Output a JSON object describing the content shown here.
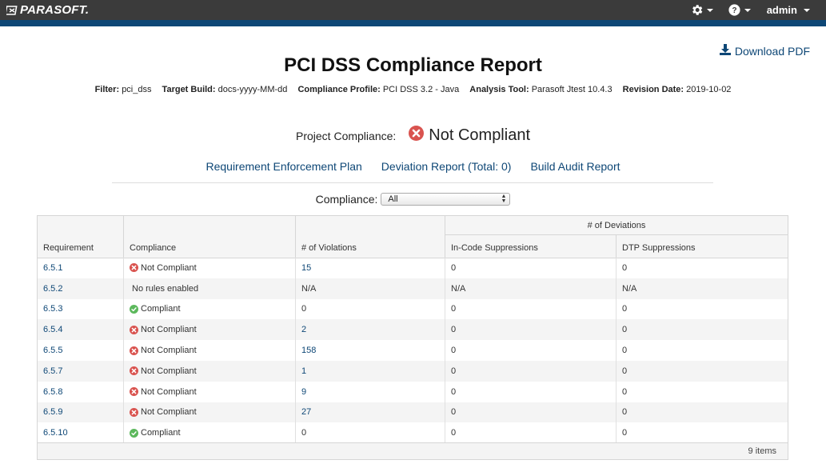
{
  "header": {
    "brand": "PARASOFT.",
    "user": "admin"
  },
  "download_label": "Download PDF",
  "report": {
    "title": "PCI DSS Compliance Report",
    "filter_label": "Filter:",
    "filter_value": "pci_dss",
    "build_label": "Target Build:",
    "build_value": "docs-yyyy-MM-dd",
    "profile_label": "Compliance Profile:",
    "profile_value": "PCI DSS 3.2 - Java",
    "tool_label": "Analysis Tool:",
    "tool_value": "Parasoft Jtest 10.4.3",
    "revision_label": "Revision Date:",
    "revision_value": "2019-10-02"
  },
  "project": {
    "label": "Project Compliance:",
    "status": "Not Compliant"
  },
  "links": {
    "enforcement_plan": "Requirement Enforcement Plan",
    "deviation_report": "Deviation Report (Total: 0)",
    "build_audit": "Build Audit Report"
  },
  "compliance_filter": {
    "label": "Compliance:",
    "selected": "All"
  },
  "table": {
    "headers": {
      "requirement": "Requirement",
      "compliance": "Compliance",
      "violations": "# of Violations",
      "deviations_group": "# of Deviations",
      "in_code": "In-Code Suppressions",
      "dtp": "DTP Suppressions"
    },
    "rows": [
      {
        "req": "6.5.1",
        "status": "Not Compliant",
        "kind": "fail",
        "violations": "15",
        "in_code": "0",
        "dtp": "0"
      },
      {
        "req": "6.5.2",
        "status": "No rules enabled",
        "kind": "none",
        "violations": "N/A",
        "in_code": "N/A",
        "dtp": "N/A"
      },
      {
        "req": "6.5.3",
        "status": "Compliant",
        "kind": "pass",
        "violations": "0",
        "in_code": "0",
        "dtp": "0"
      },
      {
        "req": "6.5.4",
        "status": "Not Compliant",
        "kind": "fail",
        "violations": "2",
        "in_code": "0",
        "dtp": "0"
      },
      {
        "req": "6.5.5",
        "status": "Not Compliant",
        "kind": "fail",
        "violations": "158",
        "in_code": "0",
        "dtp": "0"
      },
      {
        "req": "6.5.7",
        "status": "Not Compliant",
        "kind": "fail",
        "violations": "1",
        "in_code": "0",
        "dtp": "0"
      },
      {
        "req": "6.5.8",
        "status": "Not Compliant",
        "kind": "fail",
        "violations": "9",
        "in_code": "0",
        "dtp": "0"
      },
      {
        "req": "6.5.9",
        "status": "Not Compliant",
        "kind": "fail",
        "violations": "27",
        "in_code": "0",
        "dtp": "0"
      },
      {
        "req": "6.5.10",
        "status": "Compliant",
        "kind": "pass",
        "violations": "0",
        "in_code": "0",
        "dtp": "0"
      }
    ],
    "footer": "9 items"
  },
  "colors": {
    "topbar": "#3b3b3b",
    "brand_stripe": "#0e4776",
    "link": "#0e4776",
    "fail": "#d9534f",
    "pass": "#5cb85c"
  },
  "icons": {
    "settings": "gear-icon",
    "help": "help-icon",
    "download": "download-icon",
    "fail": "x-circle-icon",
    "pass": "check-circle-icon"
  }
}
